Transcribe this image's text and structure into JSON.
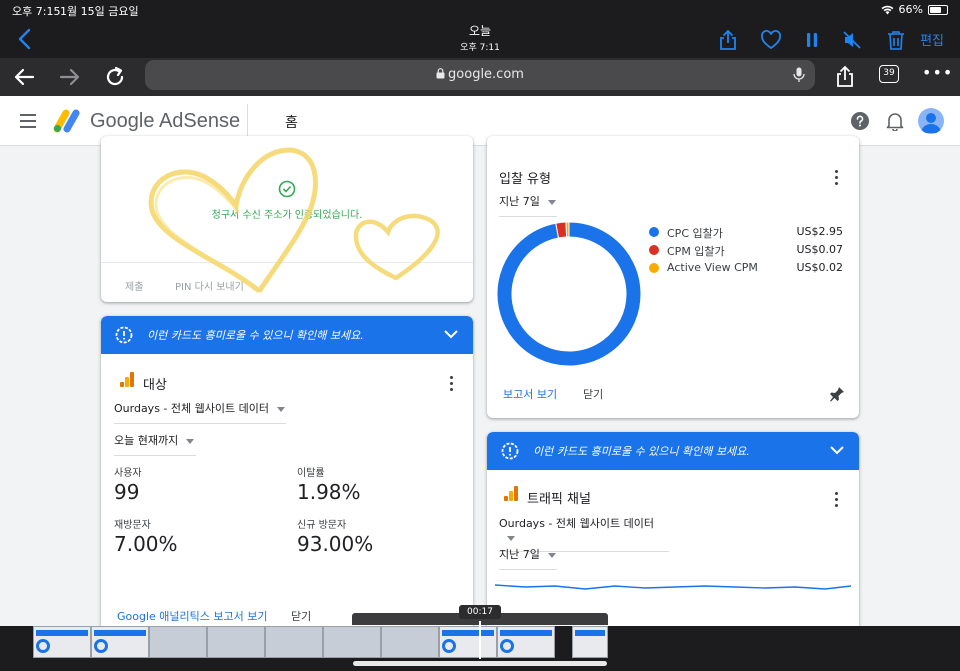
{
  "status_bar": {
    "time": "오후 7:15",
    "date": "1월 15일 금요일",
    "battery": "66%"
  },
  "viewer": {
    "title": "오늘",
    "subtitle": "오후 7:11",
    "edit_label": "편집"
  },
  "browser": {
    "url": "google.com",
    "tab_count": "39"
  },
  "appbar": {
    "brand": "Google AdSense",
    "nav_home": "홈"
  },
  "verify_card": {
    "message": "청구서 수신 주소가 인증되었습니다.",
    "submit_label": "제출",
    "resend_label": "PIN 다시 보내기"
  },
  "banners": {
    "hint_text": "이런 카드도 흥미로울 수 있으니 확인해 보세요."
  },
  "audience_card": {
    "title": "대상",
    "property_select": "Ourdays - 전체 웹사이트 데이터",
    "range_select": "오늘 현재까지",
    "metrics": [
      {
        "label": "사용자",
        "value": "99"
      },
      {
        "label": "이탈률",
        "value": "1.98%"
      },
      {
        "label": "재방문자",
        "value": "7.00%"
      },
      {
        "label": "신규 방문자",
        "value": "93.00%"
      }
    ],
    "report_link": "Google 애널리틱스 보고서 보기",
    "close_label": "닫기"
  },
  "bid_card": {
    "title": "입찰 유형",
    "range_select": "지난 7일",
    "report_link": "보고서 보기",
    "close_label": "닫기"
  },
  "traffic_card": {
    "title": "트래픽 채널",
    "property_select": "Ourdays - 전체 웹사이트 데이터",
    "range_select": "지난 7일"
  },
  "chart_data": {
    "type": "pie",
    "title": "입찰 유형",
    "donut": true,
    "series": [
      {
        "name": "CPC 입찰가",
        "value": 2.95,
        "label": "US$2.95",
        "color": "#1a73e8"
      },
      {
        "name": "CPM 입찰가",
        "value": 0.07,
        "label": "US$0.07",
        "color": "#d93025"
      },
      {
        "name": "Active View CPM",
        "value": 0.02,
        "label": "US$0.02",
        "color": "#f9ab00"
      }
    ]
  },
  "scrubber": {
    "time_label": "00:17"
  },
  "colors": {
    "accent": "#1a73e8",
    "ios_blue": "#1e84f0",
    "verified_green": "#34a853"
  }
}
